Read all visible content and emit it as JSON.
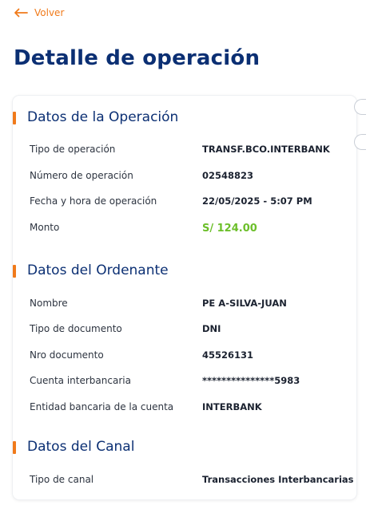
{
  "nav": {
    "back_label": "Volver"
  },
  "page_title": "Detalle de operación",
  "sections": [
    {
      "title": "Datos de la Operación",
      "rows": [
        {
          "label": "Tipo de operación",
          "value": "TRANSF.BCO.INTERBANK"
        },
        {
          "label": "Número de operación",
          "value": "02548823"
        },
        {
          "label": "Fecha y hora de operación",
          "value": "22/05/2025 - 5:07 PM"
        },
        {
          "label": "Monto",
          "value": "S/ 124.00"
        }
      ]
    },
    {
      "title": "Datos del Ordenante",
      "rows": [
        {
          "label": "Nombre",
          "value": "PE A-SILVA-JUAN"
        },
        {
          "label": "Tipo de documento",
          "value": "DNI"
        },
        {
          "label": "Nro documento",
          "value": "45526131"
        },
        {
          "label": "Cuenta interbancaria",
          "value": "***************5983"
        },
        {
          "label": "Entidad bancaria de la cuenta",
          "value": "INTERBANK"
        }
      ]
    },
    {
      "title": "Datos del Canal",
      "rows": [
        {
          "label": "Tipo de canal",
          "value": "Transacciones Interbancarias"
        }
      ]
    }
  ],
  "colors": {
    "accent": "#f07a1a",
    "title": "#0b2f73",
    "amount": "#6cbf2a"
  },
  "icons": {
    "back": "arrow-left-icon"
  }
}
